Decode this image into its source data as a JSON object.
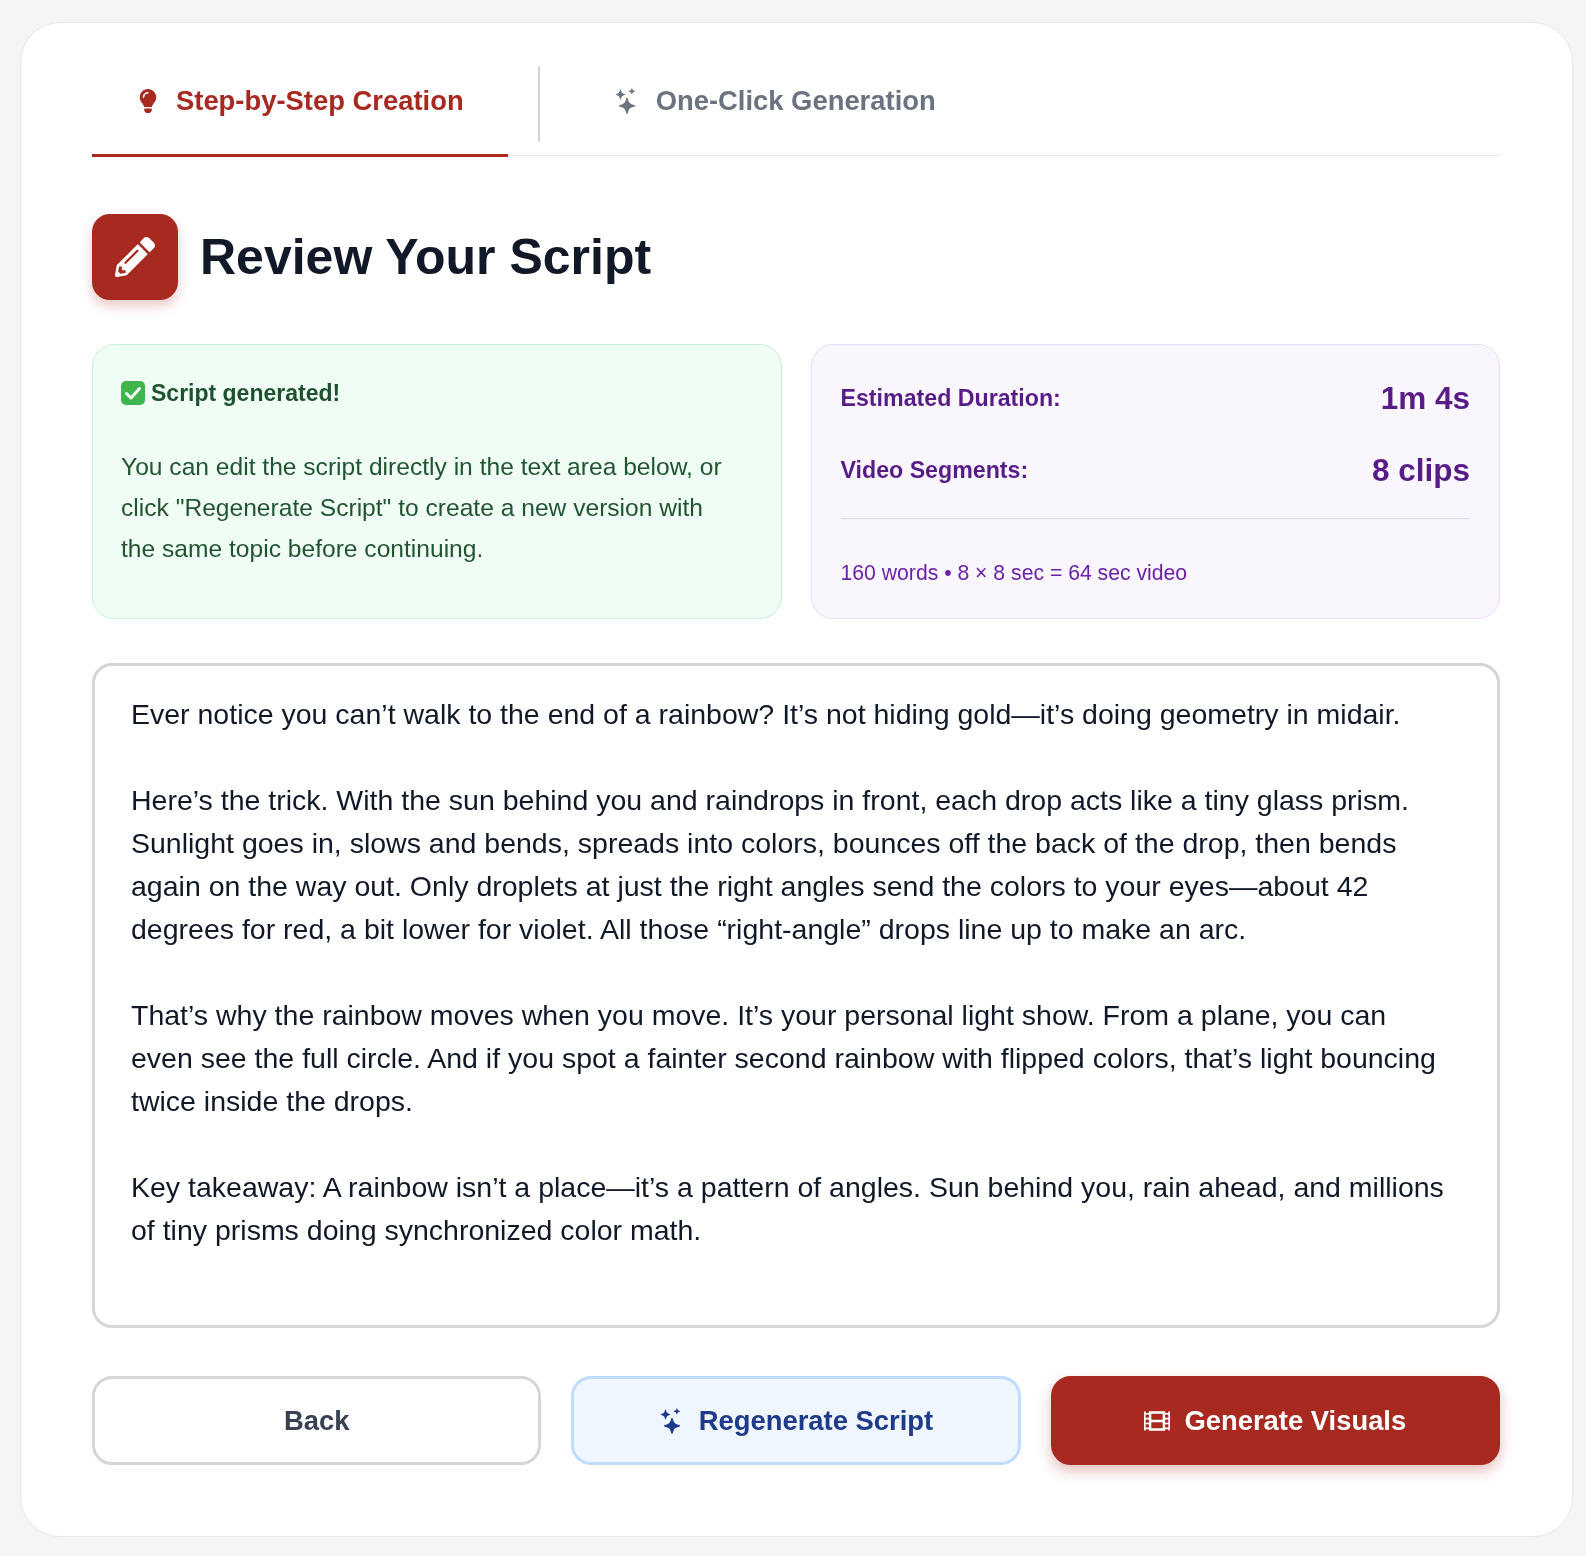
{
  "tabs": [
    {
      "label": "Step-by-Step Creation",
      "selected": true,
      "kind": "guided"
    },
    {
      "label": "One-Click Generation",
      "selected": false,
      "kind": "quick"
    }
  ],
  "heading": {
    "title": "Review Your Script"
  },
  "notice": {
    "title": "Script generated!",
    "body": "You can edit the script directly in the text area below, or click \"Regenerate Script\" to create a new version with the same topic before continuing."
  },
  "stats": {
    "rows": [
      {
        "label": "Estimated Duration:",
        "value": "1m 4s"
      },
      {
        "label": "Video Segments:",
        "value": "8 clips"
      }
    ],
    "summary": "160 words • 8 × 8 sec = 64 sec video"
  },
  "script": {
    "value": "Ever notice you can’t walk to the end of a rainbow? It’s not hiding gold—it’s doing geometry in midair.\n\nHere’s the trick. With the sun behind you and raindrops in front, each drop acts like a tiny glass prism. Sunlight goes in, slows and bends, spreads into colors, bounces off the back of the drop, then bends again on the way out. Only droplets at just the right angles send the colors to your eyes—about 42 degrees for red, a bit lower for violet. All those “right-angle” drops line up to make an arc.\n\nThat’s why the rainbow moves when you move. It’s your personal light show. From a plane, you can even see the full circle. And if you spot a fainter second rainbow with flipped colors, that’s light bouncing twice inside the drops.\n\nKey takeaway: A rainbow isn’t a place—it’s a pattern of angles. Sun behind you, rain ahead, and millions of tiny prisms doing synchronized color math."
  },
  "buttons": [
    {
      "label": "Back",
      "kind": "back"
    },
    {
      "label": "Regenerate Script",
      "kind": "regenerate"
    },
    {
      "label": "Generate Visuals",
      "kind": "generate"
    }
  ]
}
